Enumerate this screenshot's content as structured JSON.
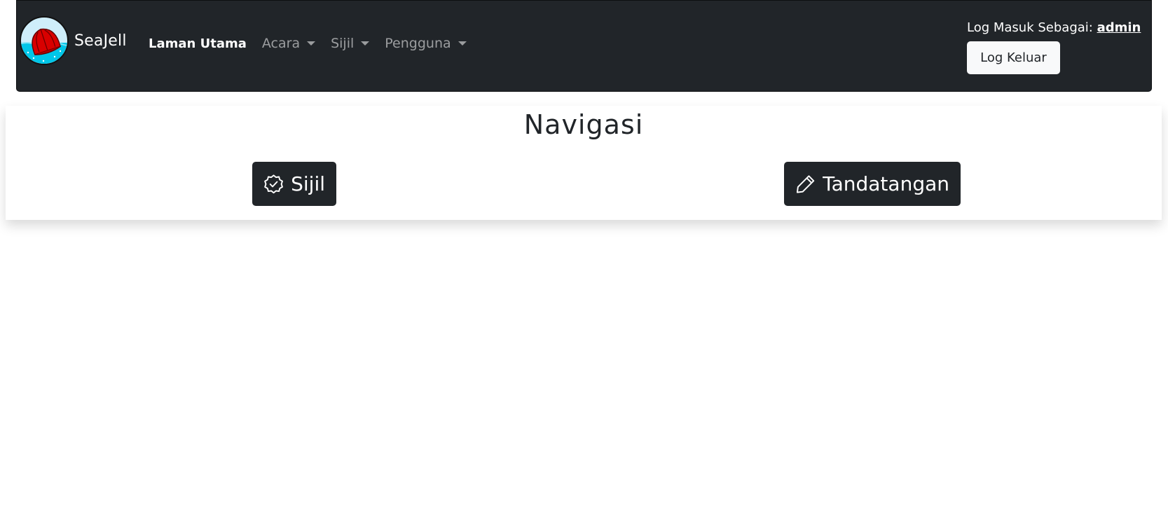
{
  "navbar": {
    "brand": "SeaJell",
    "links": [
      {
        "label": "Laman Utama",
        "active": true,
        "dropdown": false
      },
      {
        "label": "Acara",
        "active": false,
        "dropdown": true
      },
      {
        "label": "Sijil",
        "active": false,
        "dropdown": true
      },
      {
        "label": "Pengguna",
        "active": false,
        "dropdown": true
      }
    ],
    "logged_in_prefix": "Log Masuk Sebagai:",
    "username": "admin",
    "logout_label": "Log Keluar"
  },
  "main": {
    "title": "Navigasi",
    "buttons": [
      {
        "label": "Sijil",
        "icon": "patch-check-icon"
      },
      {
        "label": "Tandatangan",
        "icon": "pencil-icon"
      }
    ]
  },
  "colors": {
    "navbar_bg": "#212529",
    "logo_circle": "#00c6e8",
    "logo_jelly": "#d90000",
    "button_dark": "#212529",
    "button_light": "#f8f9fa"
  }
}
